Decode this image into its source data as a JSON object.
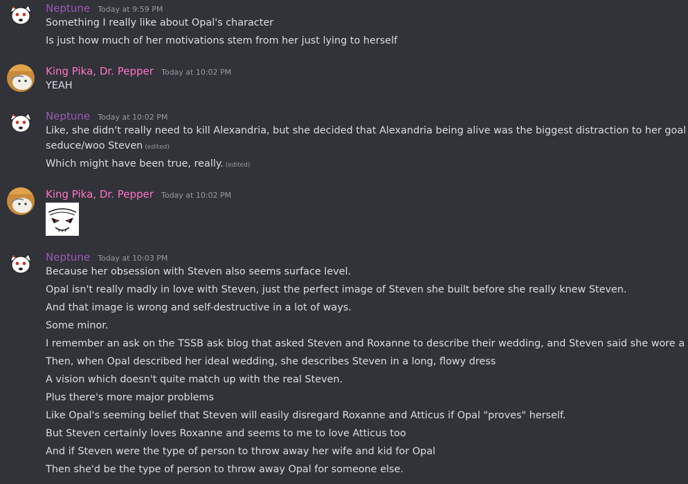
{
  "colors": {
    "background": "#313338",
    "text": "#dbdee1",
    "timestamp": "#949ba4",
    "neptune_name": "#9b59b6",
    "kingpika_name": "#ff73c7"
  },
  "messages": [
    {
      "username": "Neptune",
      "timestamp": "Today at 9:59 PM",
      "avatar_icon": "dog-avatar-icon",
      "lines": [
        {
          "text": "Something I really like about Opal's character"
        },
        {
          "text": "Is just how much of her motivations stem from her just lying to herself"
        }
      ]
    },
    {
      "username": "King Pika, Dr. Pepper",
      "timestamp": "Today at 10:02 PM",
      "avatar_icon": "pikachu-avatar-icon",
      "lines": [
        {
          "text": "YEAH"
        }
      ]
    },
    {
      "username": "Neptune",
      "timestamp": "Today at 10:02 PM",
      "avatar_icon": "dog-avatar-icon",
      "lines": [
        {
          "text": "Like, she didn't really need to kill Alexandria, but she decided that Alexandria being alive was the biggest distraction to her goal to"
        },
        {
          "text": "seduce/woo Steven",
          "edited": "(edited)"
        },
        {
          "text": "Which might have been true, really.",
          "edited": "(edited)"
        }
      ]
    },
    {
      "username": "King Pika, Dr. Pepper",
      "timestamp": "Today at 10:02 PM",
      "avatar_icon": "pikachu-avatar-icon",
      "attachment": "angry-face-sketch-image",
      "lines": []
    },
    {
      "username": "Neptune",
      "timestamp": "Today at 10:03 PM",
      "avatar_icon": "dog-avatar-icon",
      "lines": [
        {
          "text": "Because her obsession with Steven also seems surface level."
        },
        {
          "text": "Opal isn't really madly in love with Steven, just the perfect image of Steven she built before she really knew Steven."
        },
        {
          "text": "And that image is wrong and self-destructive in a lot of ways."
        },
        {
          "text": "Some minor."
        },
        {
          "text": "I remember an ask on the TSSB ask blog that asked Steven and Roxanne to describe their wedding, and Steven said she wore a suit"
        },
        {
          "text": "Then, when Opal described her ideal wedding, she describes Steven in a long, flowy dress"
        },
        {
          "text": "A vision which doesn't quite match up with the real Steven."
        },
        {
          "text": "Plus there's more major problems"
        },
        {
          "text": "Like Opal's seeming belief that Steven will easily disregard Roxanne and Atticus if Opal \"proves\" herself."
        },
        {
          "text": "But Steven certainly loves Roxanne and seems to me to love Atticus too"
        },
        {
          "text": "And if Steven were the type of person to throw away her wife and kid for Opal"
        },
        {
          "text": "Then she'd be the type of person to throw away Opal for someone else."
        }
      ]
    }
  ]
}
